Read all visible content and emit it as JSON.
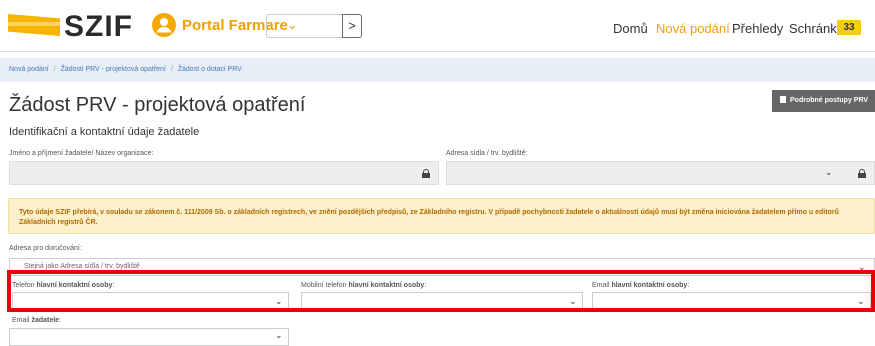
{
  "header": {
    "brand": "SZIF",
    "portal_label": "Portal Farmare",
    "go_glyph": ">",
    "nav": [
      "Domů",
      "Nová podání",
      "Přehledy",
      "Schránka"
    ],
    "active_nav": "Nová podání",
    "inbox_count": "33",
    "accent_color": "#f0a000",
    "badge_color": "#f2cc16"
  },
  "breadcrumb": [
    "Nová podání",
    "Žádosti PRV - projektová opatření",
    "Žádost o dotaci PRV"
  ],
  "breadcrumb_sep": "/",
  "page": {
    "title": "Žádost PRV - projektová opatření",
    "doc_button": "Podrobné postupy PRV",
    "section_title": "Identifikační a kontaktní údaje žadatele"
  },
  "form": {
    "name_label": "Jméno a příjmení žadatele/ Název organizace:",
    "address_label": "Adresa sídla / trv. bydliště:",
    "notice": "Tyto údaje SZIF přebírá, v souladu se zákonem č. 111/2009 Sb. o základních registrech, ve znění pozdějších předpisů, ze Základního registru. V případě pochybnosti žadatele o aktuálnosti údajů musí být změna iniciována žadatelem přímo u editorů Základních registrů ČR.",
    "delivery_label": "Adresa pro doručování:",
    "delivery_value": "Stejná jako Adresa sídla / trv. bydliště",
    "phone_label_prefix": "Telefon ",
    "phone_label_bold": "hlavní kontaktní osoby",
    "mobile_label_prefix": "Mobilní telefon ",
    "mobile_label_bold": "hlavní kontaktní osoby",
    "email_contact_label_prefix": "Email ",
    "email_contact_label_bold": "hlavní kontaktní osoby",
    "email_applicant_label_prefix": "Email ",
    "email_applicant_label_bold": "žadatele",
    "label_suffix": ":"
  }
}
